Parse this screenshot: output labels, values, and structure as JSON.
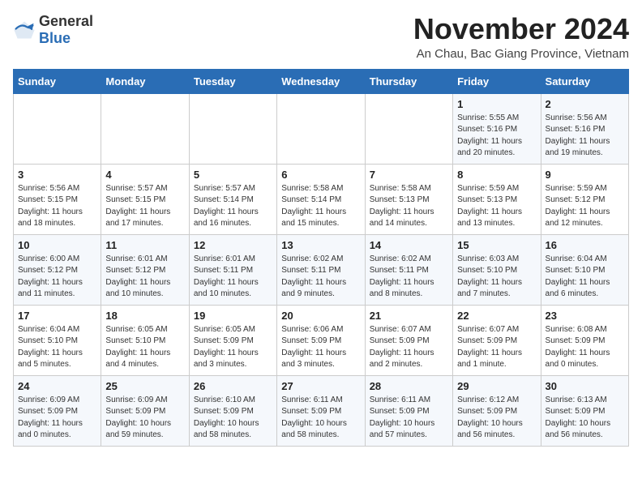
{
  "logo": {
    "general": "General",
    "blue": "Blue"
  },
  "header": {
    "month": "November 2024",
    "location": "An Chau, Bac Giang Province, Vietnam"
  },
  "weekdays": [
    "Sunday",
    "Monday",
    "Tuesday",
    "Wednesday",
    "Thursday",
    "Friday",
    "Saturday"
  ],
  "weeks": [
    [
      {
        "day": "",
        "info": ""
      },
      {
        "day": "",
        "info": ""
      },
      {
        "day": "",
        "info": ""
      },
      {
        "day": "",
        "info": ""
      },
      {
        "day": "",
        "info": ""
      },
      {
        "day": "1",
        "info": "Sunrise: 5:55 AM\nSunset: 5:16 PM\nDaylight: 11 hours and 20 minutes."
      },
      {
        "day": "2",
        "info": "Sunrise: 5:56 AM\nSunset: 5:16 PM\nDaylight: 11 hours and 19 minutes."
      }
    ],
    [
      {
        "day": "3",
        "info": "Sunrise: 5:56 AM\nSunset: 5:15 PM\nDaylight: 11 hours and 18 minutes."
      },
      {
        "day": "4",
        "info": "Sunrise: 5:57 AM\nSunset: 5:15 PM\nDaylight: 11 hours and 17 minutes."
      },
      {
        "day": "5",
        "info": "Sunrise: 5:57 AM\nSunset: 5:14 PM\nDaylight: 11 hours and 16 minutes."
      },
      {
        "day": "6",
        "info": "Sunrise: 5:58 AM\nSunset: 5:14 PM\nDaylight: 11 hours and 15 minutes."
      },
      {
        "day": "7",
        "info": "Sunrise: 5:58 AM\nSunset: 5:13 PM\nDaylight: 11 hours and 14 minutes."
      },
      {
        "day": "8",
        "info": "Sunrise: 5:59 AM\nSunset: 5:13 PM\nDaylight: 11 hours and 13 minutes."
      },
      {
        "day": "9",
        "info": "Sunrise: 5:59 AM\nSunset: 5:12 PM\nDaylight: 11 hours and 12 minutes."
      }
    ],
    [
      {
        "day": "10",
        "info": "Sunrise: 6:00 AM\nSunset: 5:12 PM\nDaylight: 11 hours and 11 minutes."
      },
      {
        "day": "11",
        "info": "Sunrise: 6:01 AM\nSunset: 5:12 PM\nDaylight: 11 hours and 10 minutes."
      },
      {
        "day": "12",
        "info": "Sunrise: 6:01 AM\nSunset: 5:11 PM\nDaylight: 11 hours and 10 minutes."
      },
      {
        "day": "13",
        "info": "Sunrise: 6:02 AM\nSunset: 5:11 PM\nDaylight: 11 hours and 9 minutes."
      },
      {
        "day": "14",
        "info": "Sunrise: 6:02 AM\nSunset: 5:11 PM\nDaylight: 11 hours and 8 minutes."
      },
      {
        "day": "15",
        "info": "Sunrise: 6:03 AM\nSunset: 5:10 PM\nDaylight: 11 hours and 7 minutes."
      },
      {
        "day": "16",
        "info": "Sunrise: 6:04 AM\nSunset: 5:10 PM\nDaylight: 11 hours and 6 minutes."
      }
    ],
    [
      {
        "day": "17",
        "info": "Sunrise: 6:04 AM\nSunset: 5:10 PM\nDaylight: 11 hours and 5 minutes."
      },
      {
        "day": "18",
        "info": "Sunrise: 6:05 AM\nSunset: 5:10 PM\nDaylight: 11 hours and 4 minutes."
      },
      {
        "day": "19",
        "info": "Sunrise: 6:05 AM\nSunset: 5:09 PM\nDaylight: 11 hours and 3 minutes."
      },
      {
        "day": "20",
        "info": "Sunrise: 6:06 AM\nSunset: 5:09 PM\nDaylight: 11 hours and 3 minutes."
      },
      {
        "day": "21",
        "info": "Sunrise: 6:07 AM\nSunset: 5:09 PM\nDaylight: 11 hours and 2 minutes."
      },
      {
        "day": "22",
        "info": "Sunrise: 6:07 AM\nSunset: 5:09 PM\nDaylight: 11 hours and 1 minute."
      },
      {
        "day": "23",
        "info": "Sunrise: 6:08 AM\nSunset: 5:09 PM\nDaylight: 11 hours and 0 minutes."
      }
    ],
    [
      {
        "day": "24",
        "info": "Sunrise: 6:09 AM\nSunset: 5:09 PM\nDaylight: 11 hours and 0 minutes."
      },
      {
        "day": "25",
        "info": "Sunrise: 6:09 AM\nSunset: 5:09 PM\nDaylight: 10 hours and 59 minutes."
      },
      {
        "day": "26",
        "info": "Sunrise: 6:10 AM\nSunset: 5:09 PM\nDaylight: 10 hours and 58 minutes."
      },
      {
        "day": "27",
        "info": "Sunrise: 6:11 AM\nSunset: 5:09 PM\nDaylight: 10 hours and 58 minutes."
      },
      {
        "day": "28",
        "info": "Sunrise: 6:11 AM\nSunset: 5:09 PM\nDaylight: 10 hours and 57 minutes."
      },
      {
        "day": "29",
        "info": "Sunrise: 6:12 AM\nSunset: 5:09 PM\nDaylight: 10 hours and 56 minutes."
      },
      {
        "day": "30",
        "info": "Sunrise: 6:13 AM\nSunset: 5:09 PM\nDaylight: 10 hours and 56 minutes."
      }
    ]
  ]
}
